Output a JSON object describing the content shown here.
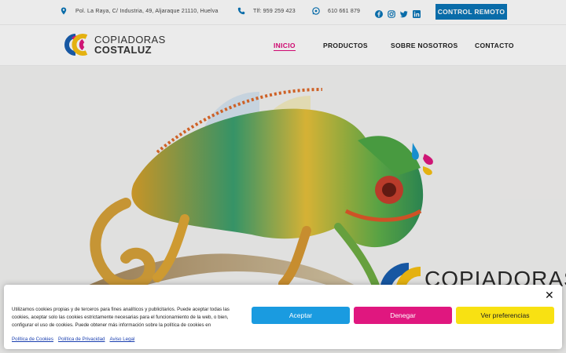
{
  "topbar": {
    "address": "Pol. La Raya, C/ Industria, 49, Aljaraque 21110, Huelva",
    "phone": "Tlf: 959 259 423",
    "whatsapp": "610 661 879",
    "remote_button": "CONTROL REMOTO",
    "social_icons": [
      "facebook-icon",
      "instagram-icon",
      "twitter-icon",
      "linkedin-icon"
    ]
  },
  "logo": {
    "line1": "COPIADORAS",
    "line2": "COSTALUZ"
  },
  "nav": [
    {
      "label": "INICIO",
      "active": true
    },
    {
      "label": "PRODUCTOS",
      "active": false
    },
    {
      "label": "SOBRE NOSOTROS",
      "active": false
    },
    {
      "label": "CONTACTO",
      "active": false
    }
  ],
  "hero": {
    "watermark_text": "COPIADORAS"
  },
  "cookie": {
    "text": "Utilizamos cookies propias y de terceros para fines analíticos y publicitarios. Puede aceptar todas las cookies, aceptar solo las cookies estrictamente necesarias para el funcionamiento de la web, o bien, configurar el uso de cookies. Puede obtener más información sobre la política de cookies en",
    "accept": "Aceptar",
    "deny": "Denegar",
    "preferences": "Ver preferencias",
    "close": "✕",
    "links": [
      "Política de Cookies",
      "Política de Privacidad",
      "Aviso Legal"
    ]
  },
  "colors": {
    "brand_blue": "#0a76b8",
    "magenta": "#e0177f",
    "yellow": "#f8e112",
    "cyan": "#1a9be0"
  }
}
